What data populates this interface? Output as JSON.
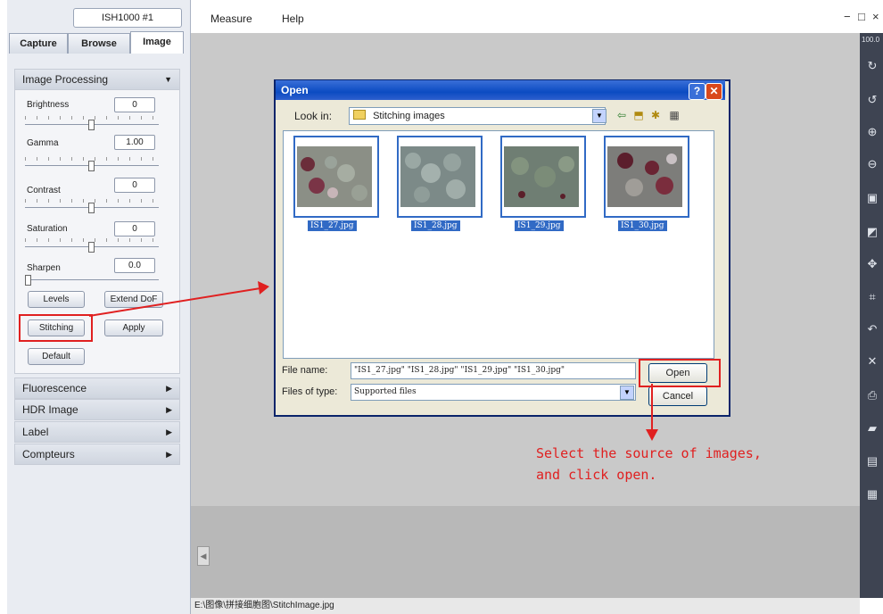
{
  "app": {
    "device": "ISH1000 #1",
    "tabs": [
      "Capture",
      "Browse",
      "Image"
    ],
    "menu": [
      "Measure",
      "Help"
    ],
    "zoom": "100.0",
    "window_controls": [
      "−",
      "□",
      "×"
    ]
  },
  "image_processing": {
    "title": "Image Processing",
    "params": [
      {
        "label": "Brightness",
        "value": "0",
        "level": 0.5
      },
      {
        "label": "Gamma",
        "value": "1.00",
        "level": 0.5
      },
      {
        "label": "Contrast",
        "value": "0",
        "level": 0.5
      },
      {
        "label": "Saturation",
        "value": "0",
        "level": 0.5
      },
      {
        "label": "Sharpen",
        "value": "0.0",
        "level": 0.0
      }
    ],
    "buttons": {
      "levels": "Levels",
      "extend_dof": "Extend DoF",
      "stitching": "Stitching",
      "apply": "Apply",
      "default": "Default"
    }
  },
  "sections": [
    "Fluorescence",
    "HDR Image",
    "Label",
    "Compteurs"
  ],
  "dialog": {
    "title": "Open",
    "look_in_label": "Look in:",
    "look_in_value": "Stitching images",
    "files": [
      "IS1_27.jpg",
      "IS1_28.jpg",
      "IS1_29.jpg",
      "IS1_30.jpg"
    ],
    "file_name_label": "File name:",
    "file_name_value": "\"IS1_27.jpg\" \"IS1_28.jpg\" \"IS1_29.jpg\" \"IS1_30.jpg\"",
    "files_of_type_label": "Files of type:",
    "files_of_type_value": "Supported files",
    "open_button": "Open",
    "cancel_button": "Cancel"
  },
  "annotation": {
    "line1": "Select the source of images,",
    "line2": "and click open."
  },
  "status_path": "E:\\图像\\拼接细胞图\\StitchImage.jpg",
  "colors": {
    "annotation_red": "#e02020",
    "title_blue": "#0b4bc2",
    "selection_blue": "#316ac5"
  }
}
